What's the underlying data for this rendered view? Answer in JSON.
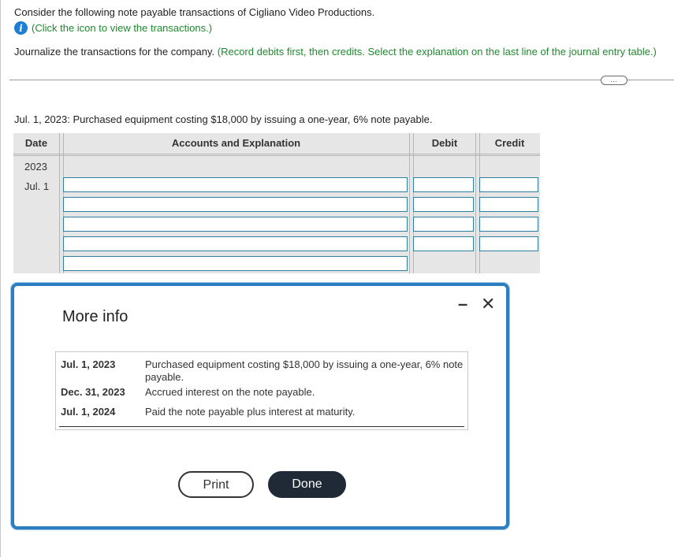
{
  "header": {
    "intro": "Consider the following note payable transactions of Cigliano Video Productions.",
    "info_link": "(Click the icon to view the transactions.)",
    "instruction_main": "Journalize the transactions for the company.",
    "instruction_hint": "(Record debits first, then credits. Select the explanation on the last line of the journal entry table.)",
    "more_button": "…"
  },
  "journal": {
    "prompt": "Jul. 1, 2023: Purchased equipment costing $18,000 by issuing a one-year, 6% note payable.",
    "columns": {
      "date": "Date",
      "accounts": "Accounts and Explanation",
      "debit": "Debit",
      "credit": "Credit"
    },
    "year": "2023",
    "date": "Jul. 1"
  },
  "modal": {
    "title": "More info",
    "minimize_glyph": "–",
    "close_glyph": "✕",
    "transactions": [
      {
        "date": "Jul. 1, 2023",
        "description": "Purchased equipment costing $18,000 by issuing a one-year, 6% note payable."
      },
      {
        "date": "Dec. 31, 2023",
        "description": "Accrued interest on the note payable."
      },
      {
        "date": "Jul. 1, 2024",
        "description": "Paid the note payable plus interest at maturity."
      }
    ],
    "print_label": "Print",
    "done_label": "Done"
  }
}
